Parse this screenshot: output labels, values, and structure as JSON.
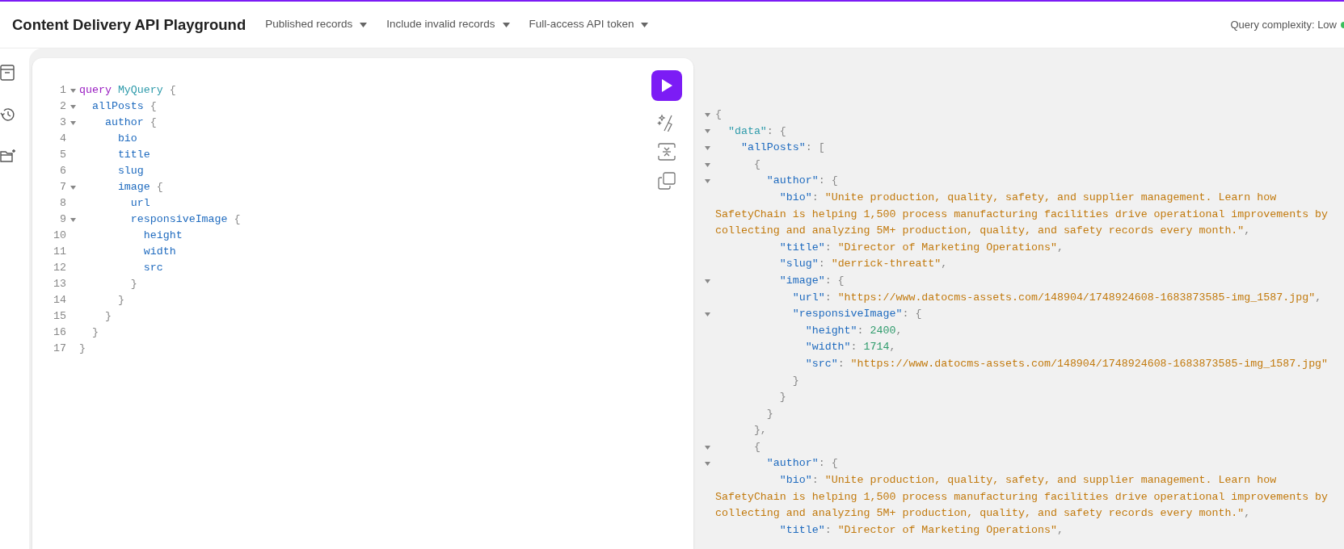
{
  "header": {
    "title": "Content Delivery API Playground",
    "menus": [
      {
        "label": "Published records"
      },
      {
        "label": "Include invalid records"
      },
      {
        "label": "Full-access API token"
      }
    ],
    "complexity": "Query complexity: Low"
  },
  "editor": {
    "lines": [
      {
        "number": "1",
        "fold": true,
        "tokens": [
          {
            "kind": "keyword",
            "text": "query "
          },
          {
            "kind": "name",
            "text": "MyQuery"
          },
          {
            "kind": "punct",
            "text": " {"
          }
        ]
      },
      {
        "number": "2",
        "fold": true,
        "tokens": [
          {
            "kind": "field",
            "text": "  allPosts"
          },
          {
            "kind": "punct",
            "text": " {"
          }
        ]
      },
      {
        "number": "3",
        "fold": true,
        "tokens": [
          {
            "kind": "field",
            "text": "    author"
          },
          {
            "kind": "punct",
            "text": " {"
          }
        ]
      },
      {
        "number": "4",
        "fold": false,
        "tokens": [
          {
            "kind": "field",
            "text": "      bio"
          }
        ]
      },
      {
        "number": "5",
        "fold": false,
        "tokens": [
          {
            "kind": "field",
            "text": "      title"
          }
        ]
      },
      {
        "number": "6",
        "fold": false,
        "tokens": [
          {
            "kind": "field",
            "text": "      slug"
          }
        ]
      },
      {
        "number": "7",
        "fold": true,
        "tokens": [
          {
            "kind": "field",
            "text": "      image"
          },
          {
            "kind": "punct",
            "text": " {"
          }
        ]
      },
      {
        "number": "8",
        "fold": false,
        "tokens": [
          {
            "kind": "field",
            "text": "        url"
          }
        ]
      },
      {
        "number": "9",
        "fold": true,
        "tokens": [
          {
            "kind": "field",
            "text": "        responsiveImage"
          },
          {
            "kind": "punct",
            "text": " {"
          }
        ]
      },
      {
        "number": "10",
        "fold": false,
        "tokens": [
          {
            "kind": "field",
            "text": "          height"
          }
        ]
      },
      {
        "number": "11",
        "fold": false,
        "tokens": [
          {
            "kind": "field",
            "text": "          width"
          }
        ]
      },
      {
        "number": "12",
        "fold": false,
        "tokens": [
          {
            "kind": "field",
            "text": "          src"
          }
        ]
      },
      {
        "number": "13",
        "fold": false,
        "tokens": [
          {
            "kind": "punct",
            "text": "        }"
          }
        ]
      },
      {
        "number": "14",
        "fold": false,
        "tokens": [
          {
            "kind": "punct",
            "text": "      }"
          }
        ]
      },
      {
        "number": "15",
        "fold": false,
        "tokens": [
          {
            "kind": "punct",
            "text": "    }"
          }
        ]
      },
      {
        "number": "16",
        "fold": false,
        "tokens": [
          {
            "kind": "punct",
            "text": "  }"
          }
        ]
      },
      {
        "number": "17",
        "fold": false,
        "tokens": [
          {
            "kind": "punct",
            "text": "}"
          }
        ]
      }
    ]
  },
  "result": {
    "lines": [
      {
        "fold": true,
        "tokens": [
          {
            "kind": "punct",
            "text": "{"
          }
        ]
      },
      {
        "fold": true,
        "tokens": [
          {
            "kind": "root_key",
            "text": "  \"data\""
          },
          {
            "kind": "punct",
            "text": ": {"
          }
        ]
      },
      {
        "fold": true,
        "tokens": [
          {
            "kind": "key",
            "text": "    \"allPosts\""
          },
          {
            "kind": "punct",
            "text": ": ["
          }
        ]
      },
      {
        "fold": true,
        "tokens": [
          {
            "kind": "punct",
            "text": "      {"
          }
        ]
      },
      {
        "fold": true,
        "tokens": [
          {
            "kind": "key",
            "text": "        \"author\""
          },
          {
            "kind": "punct",
            "text": ": {"
          }
        ]
      },
      {
        "fold": false,
        "tokens": [
          {
            "kind": "key",
            "text": "          \"bio\""
          },
          {
            "kind": "punct",
            "text": ": "
          },
          {
            "kind": "string",
            "text": "\"Unite production, quality, safety, and supplier management. Learn how SafetyChain is helping 1,500 process manufacturing facilities drive operational improvements by collecting and analyzing 5M+ production, quality, and safety records every month.\""
          },
          {
            "kind": "punct",
            "text": ","
          }
        ]
      },
      {
        "fold": false,
        "tokens": [
          {
            "kind": "key",
            "text": "          \"title\""
          },
          {
            "kind": "punct",
            "text": ": "
          },
          {
            "kind": "string",
            "text": "\"Director of Marketing Operations\""
          },
          {
            "kind": "punct",
            "text": ","
          }
        ]
      },
      {
        "fold": false,
        "tokens": [
          {
            "kind": "key",
            "text": "          \"slug\""
          },
          {
            "kind": "punct",
            "text": ": "
          },
          {
            "kind": "string",
            "text": "\"derrick-threatt\""
          },
          {
            "kind": "punct",
            "text": ","
          }
        ]
      },
      {
        "fold": true,
        "tokens": [
          {
            "kind": "key",
            "text": "          \"image\""
          },
          {
            "kind": "punct",
            "text": ": {"
          }
        ]
      },
      {
        "fold": false,
        "tokens": [
          {
            "kind": "key",
            "text": "            \"url\""
          },
          {
            "kind": "punct",
            "text": ": "
          },
          {
            "kind": "string",
            "text": "\"https://www.datocms-assets.com/148904/1748924608-1683873585-img_1587.jpg\""
          },
          {
            "kind": "punct",
            "text": ","
          }
        ]
      },
      {
        "fold": true,
        "tokens": [
          {
            "kind": "key",
            "text": "            \"responsiveImage\""
          },
          {
            "kind": "punct",
            "text": ": {"
          }
        ]
      },
      {
        "fold": false,
        "tokens": [
          {
            "kind": "key",
            "text": "              \"height\""
          },
          {
            "kind": "punct",
            "text": ": "
          },
          {
            "kind": "number",
            "text": "2400"
          },
          {
            "kind": "punct",
            "text": ","
          }
        ]
      },
      {
        "fold": false,
        "tokens": [
          {
            "kind": "key",
            "text": "              \"width\""
          },
          {
            "kind": "punct",
            "text": ": "
          },
          {
            "kind": "number",
            "text": "1714"
          },
          {
            "kind": "punct",
            "text": ","
          }
        ]
      },
      {
        "fold": false,
        "tokens": [
          {
            "kind": "key",
            "text": "              \"src\""
          },
          {
            "kind": "punct",
            "text": ": "
          },
          {
            "kind": "string",
            "text": "\"https://www.datocms-assets.com/148904/1748924608-1683873585-img_1587.jpg\""
          }
        ]
      },
      {
        "fold": false,
        "tokens": [
          {
            "kind": "punct",
            "text": "            }"
          }
        ]
      },
      {
        "fold": false,
        "tokens": [
          {
            "kind": "punct",
            "text": "          }"
          }
        ]
      },
      {
        "fold": false,
        "tokens": [
          {
            "kind": "punct",
            "text": "        }"
          }
        ]
      },
      {
        "fold": false,
        "tokens": [
          {
            "kind": "punct",
            "text": "      },"
          }
        ]
      },
      {
        "fold": true,
        "tokens": [
          {
            "kind": "punct",
            "text": "      {"
          }
        ]
      },
      {
        "fold": true,
        "tokens": [
          {
            "kind": "key",
            "text": "        \"author\""
          },
          {
            "kind": "punct",
            "text": ": {"
          }
        ]
      },
      {
        "fold": false,
        "tokens": [
          {
            "kind": "key",
            "text": "          \"bio\""
          },
          {
            "kind": "punct",
            "text": ": "
          },
          {
            "kind": "string",
            "text": "\"Unite production, quality, safety, and supplier management. Learn how SafetyChain is helping 1,500 process manufacturing facilities drive operational improvements by collecting and analyzing 5M+ production, quality, and safety records every month.\""
          },
          {
            "kind": "punct",
            "text": ","
          }
        ]
      },
      {
        "fold": false,
        "tokens": [
          {
            "kind": "key",
            "text": "          \"title\""
          },
          {
            "kind": "punct",
            "text": ": "
          },
          {
            "kind": "string",
            "text": "\"Director of Marketing Operations\""
          },
          {
            "kind": "punct",
            "text": ","
          }
        ]
      }
    ]
  }
}
